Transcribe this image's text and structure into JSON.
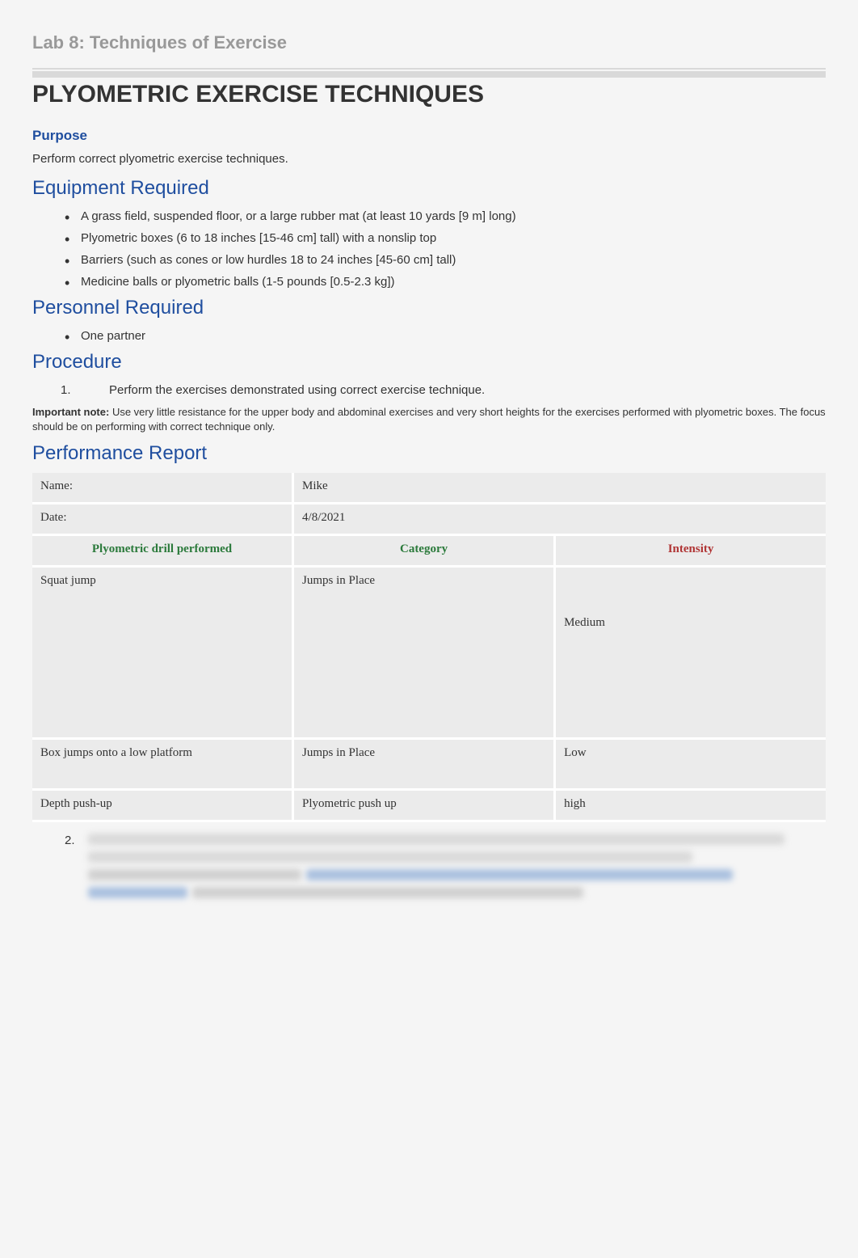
{
  "subtitle": "Lab 8: Techniques of Exercise",
  "main_title": "PLYOMETRIC EXERCISE TECHNIQUES",
  "sections": {
    "purpose": {
      "label": "Purpose",
      "text": "Perform correct plyometric exercise techniques."
    },
    "equipment": {
      "label": "Equipment Required",
      "items": [
        "A grass field, suspended floor, or a large rubber mat (at least 10 yards [9 m] long)",
        "Plyometric boxes (6 to 18 inches [15-46 cm] tall) with a nonslip top",
        "Barriers (such as cones or low hurdles 18 to 24 inches [45-60 cm] tall)",
        "Medicine balls or plyometric balls (1-5 pounds [0.5-2.3 kg])"
      ]
    },
    "personnel": {
      "label": "Personnel Required",
      "items": [
        "One partner"
      ]
    },
    "procedure": {
      "label": "Procedure",
      "items": [
        "Perform the exercises demonstrated using correct exercise technique."
      ],
      "note_label": "Important note:",
      "note_text": " Use very little resistance for the upper body and abdominal exercises and very short heights for the exercises performed with plyometric boxes. The focus should be on performing with correct technique only."
    },
    "report": {
      "label": "Performance Report",
      "name_label": "Name:",
      "name_value": "Mike",
      "date_label": "Date:",
      "date_value": "4/8/2021",
      "headers": {
        "col1": "Plyometric drill performed",
        "col2": "Category",
        "col3": "Intensity"
      },
      "rows": [
        {
          "drill": "Squat jump",
          "category": "Jumps in Place",
          "intensity": "Medium"
        },
        {
          "drill": " Box jumps onto a low platform",
          "category": "Jumps in Place",
          "intensity": "Low"
        },
        {
          "drill": "Depth push-up",
          "category": "Plyometric push up",
          "intensity": "high"
        }
      ]
    }
  },
  "blurred_item_number": "2."
}
